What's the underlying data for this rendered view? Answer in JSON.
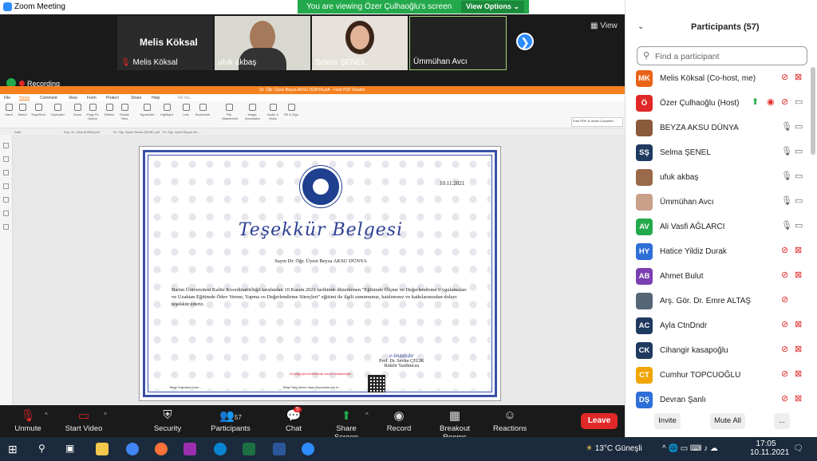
{
  "window": {
    "title": "Zoom Meeting",
    "minimize": "—",
    "maximize": "❐",
    "close": "✕"
  },
  "banner": {
    "viewing": "You are viewing Özer Çulhaoğlu's screen",
    "view_options": "View Options ⌄"
  },
  "gallery": {
    "tiles": [
      {
        "name": "Melis Köksal",
        "big_name": "Melis Köksal",
        "muted": true
      },
      {
        "name": "ufuk akbaş"
      },
      {
        "name": "Selma ŞENEL"
      },
      {
        "name": "Ümmühan Avcı"
      }
    ],
    "next": "❯",
    "view": "View"
  },
  "recording": "Recording",
  "foxit": {
    "title": "Dr. Öğr. Üyesi Beyza AKSU DÜNYA.pdf - Foxit PDF Reader",
    "menu": [
      "File",
      "Home",
      "Comment",
      "View",
      "Form",
      "Protect",
      "Share",
      "Help",
      "Tell me..."
    ],
    "ribbon": [
      "Hand",
      "Select",
      "SnapShot",
      "Clipboard",
      "Zoom",
      "Page Fit Option",
      "Reflow",
      "Rotate View",
      "Typewriter",
      "Highlight",
      "Link",
      "Bookmark",
      "File Attachment",
      "Image Annotation",
      "Audio & Video",
      "Fill & Sign"
    ],
    "tabs": [
      "Start",
      "Doç. Dr. Ufuk AKBAŞ.pdf",
      "Dr. Öğr. Üyesi Selma ŞENEL.pdf",
      "Dr. Öğr. Üyesi Beyza AK..."
    ],
    "promo": "Free PDF to Word Converter"
  },
  "certificate": {
    "date": "10.11.2021",
    "title": "Teşekkür Belgesi",
    "recipient": "Sayın Dr. Öğr. Üyesi Beyza AKSU DÜNYA",
    "body": "Bartın Üniversitesi Kalite Koordinatörlüğü tarafından 10 Kasım 2021 tarihinde düzenlenen \"Eğitimde Ölçme ve Değerlendirme Uygulamaları ve Uzaktan Eğitimde Ödev Verme, Yapma ve Değerlendirme Süreçleri\" eğitimi ile ilgili sunumunuz, katılımınız ve katkılarınızdan dolayı teşekkür ederiz.",
    "signature": "e-imzalıdır",
    "signer": "Prof. Dr. Sevim ÇELİK",
    "signer_title": "Rektör Yardımcısı",
    "red_note": "Bu belge güvenli elektronik imza ile imzalanmıştır.",
    "foot_left": "Belge Doğrulama Kodu: ...",
    "foot_right": "Belge Takip Adresi: https://ebys.bartin.edu.tr/..."
  },
  "participants": {
    "header": "Participants (57)",
    "search_placeholder": "Find a participant",
    "list": [
      {
        "initials": "MK",
        "color": "#e8631a",
        "name": "Melis Köksal (Co-host, me)",
        "mic": "off",
        "cam": "off"
      },
      {
        "initials": "Ö",
        "color": "#e02828",
        "name": "Özer Çulhaoğlu (Host)",
        "mic": "off",
        "cam": "on",
        "share": true
      },
      {
        "initials": "",
        "color": "#8a5a3a",
        "name": "BEYZA AKSU DÜNYA",
        "mic": "on",
        "cam": "on"
      },
      {
        "initials": "SŞ",
        "color": "#1f3a5f",
        "name": "Selma ŞENEL",
        "mic": "on",
        "cam": "on"
      },
      {
        "initials": "",
        "color": "#9b6a4a",
        "name": "ufuk akbaş",
        "mic": "on",
        "cam": "on"
      },
      {
        "initials": "",
        "color": "#c9a08a",
        "name": "Ümmühan Avcı",
        "mic": "on",
        "cam": "on"
      },
      {
        "initials": "AV",
        "color": "#23a94b",
        "name": "Ali Vasfi AĞLARCI",
        "mic": "on",
        "cam": "on"
      },
      {
        "initials": "HY",
        "color": "#2d6fd6",
        "name": "Hatice Yildiz Durak",
        "mic": "off",
        "cam": "off"
      },
      {
        "initials": "AB",
        "color": "#7a3fb0",
        "name": "Ahmet Bulut",
        "mic": "off",
        "cam": "off"
      },
      {
        "initials": "",
        "color": "#556677",
        "name": "Arş. Gör. Dr. Emre ALTAŞ",
        "mic": "off",
        "cam": "none"
      },
      {
        "initials": "AC",
        "color": "#1f3a5f",
        "name": "Ayla CtnDndr",
        "mic": "off",
        "cam": "off"
      },
      {
        "initials": "CK",
        "color": "#1f3a5f",
        "name": "Cihangir kasapoğlu",
        "mic": "off",
        "cam": "off"
      },
      {
        "initials": "CT",
        "color": "#f0a500",
        "name": "Cumhur TOPCUOĞLU",
        "mic": "off",
        "cam": "off"
      },
      {
        "initials": "DŞ",
        "color": "#2d6fd6",
        "name": "Devran Şanlı",
        "mic": "off",
        "cam": "off"
      }
    ],
    "invite": "Invite",
    "mute_all": "Mute All",
    "more": "..."
  },
  "toolbar": {
    "unmute": "Unmute",
    "start_video": "Start Video",
    "security": "Security",
    "participants": "Participants",
    "participants_count": "57",
    "chat": "Chat",
    "chat_badge": "5",
    "share": "Share Screen",
    "record": "Record",
    "breakout": "Breakout Rooms",
    "reactions": "Reactions",
    "leave": "Leave"
  },
  "taskbar": {
    "weather": "13°C Güneşli",
    "time": "17:05",
    "date": "10.11.2021"
  },
  "colors": {
    "accent": "#2d8cff",
    "green": "#23a94b",
    "red": "#e02828",
    "foxit": "#f48120"
  }
}
